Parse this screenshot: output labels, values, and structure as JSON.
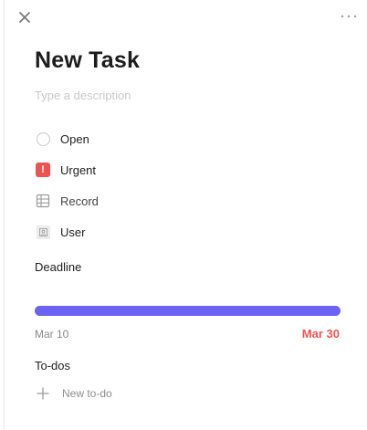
{
  "header": {
    "close_icon": "close-icon",
    "more_icon": "more-horizontal-icon"
  },
  "task": {
    "title": "New Task",
    "description_placeholder": "Type a description",
    "description_value": ""
  },
  "properties": [
    {
      "icon": "status-circle-icon",
      "label": "Open"
    },
    {
      "icon": "urgent-exclamation-icon",
      "label": "Urgent",
      "icon_glyph": "!",
      "accent": "#ef5350"
    },
    {
      "icon": "table-icon",
      "label": "Record"
    },
    {
      "icon": "user-icon",
      "label": "User"
    }
  ],
  "deadline": {
    "label": "Deadline",
    "start_date": "Mar 10",
    "end_date": "Mar 30",
    "progress": 1.0,
    "bar_color": "#6c63f5",
    "end_date_color": "#ef5350"
  },
  "todos": {
    "label": "To-dos",
    "new_placeholder": "New to-do"
  }
}
